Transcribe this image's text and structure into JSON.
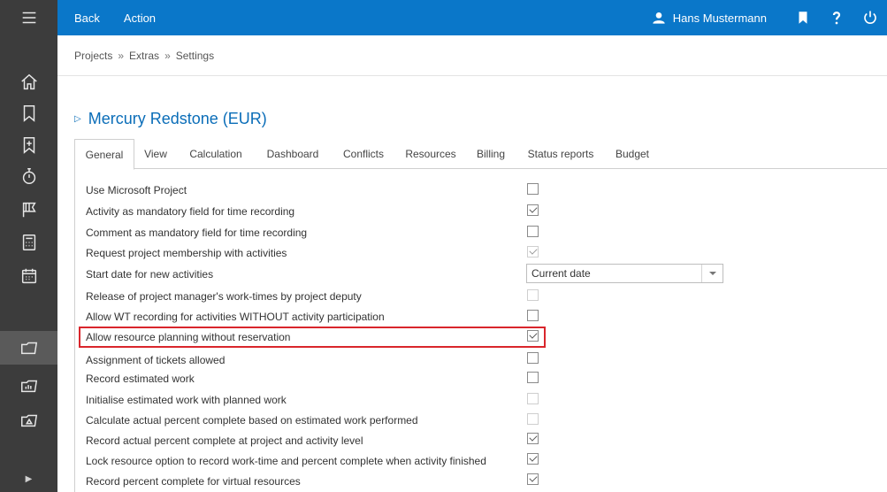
{
  "topbar": {
    "back_label": "Back",
    "action_label": "Action",
    "user_name": "Hans Mustermann"
  },
  "breadcrumb": {
    "items": [
      "Projects",
      "Extras",
      "Settings"
    ],
    "separator": "»"
  },
  "project": {
    "title": "Mercury Redstone (EUR)"
  },
  "tabs": [
    "General",
    "View",
    "Calculation",
    "Dashboard",
    "Conflicts",
    "Resources",
    "Billing",
    "Status reports",
    "Budget"
  ],
  "active_tab": "General",
  "start_date_select": {
    "value": "Current date"
  },
  "settings": [
    {
      "label": "Use Microsoft Project",
      "checked": false,
      "disabled": false
    },
    {
      "label": "Activity as mandatory field for time recording",
      "checked": true,
      "disabled": false
    },
    {
      "label": "Comment as mandatory field for time recording",
      "checked": false,
      "disabled": false
    },
    {
      "label": "Request project membership with activities",
      "checked": true,
      "disabled": true
    },
    {
      "label": "Start date for new activities",
      "type": "select"
    },
    {
      "label": "Release of project manager's work-times by project deputy",
      "checked": false,
      "disabled": true
    },
    {
      "label": "Allow WT recording for activities WITHOUT activity participation",
      "checked": false,
      "disabled": false
    },
    {
      "label": "Allow resource planning without reservation",
      "checked": true,
      "disabled": false,
      "highlighted": true
    },
    {
      "label": "Assignment of tickets allowed",
      "checked": false,
      "disabled": false
    },
    {
      "label": "Record estimated work",
      "checked": false,
      "disabled": false
    },
    {
      "label": "Initialise estimated work with planned work",
      "checked": false,
      "disabled": true
    },
    {
      "label": "Calculate actual percent complete based on estimated work performed",
      "checked": false,
      "disabled": true
    },
    {
      "label": "Record actual percent complete at project and activity level",
      "checked": true,
      "disabled": false
    },
    {
      "label": "Lock resource option to record work-time and percent complete when activity finished",
      "checked": true,
      "disabled": false
    },
    {
      "label": "Record percent complete for virtual resources",
      "checked": true,
      "disabled": false
    }
  ],
  "colors": {
    "topbar": "#0a77c9",
    "rail": "#3c3c3c",
    "title": "#0a6db8",
    "highlight": "#d9262c"
  }
}
